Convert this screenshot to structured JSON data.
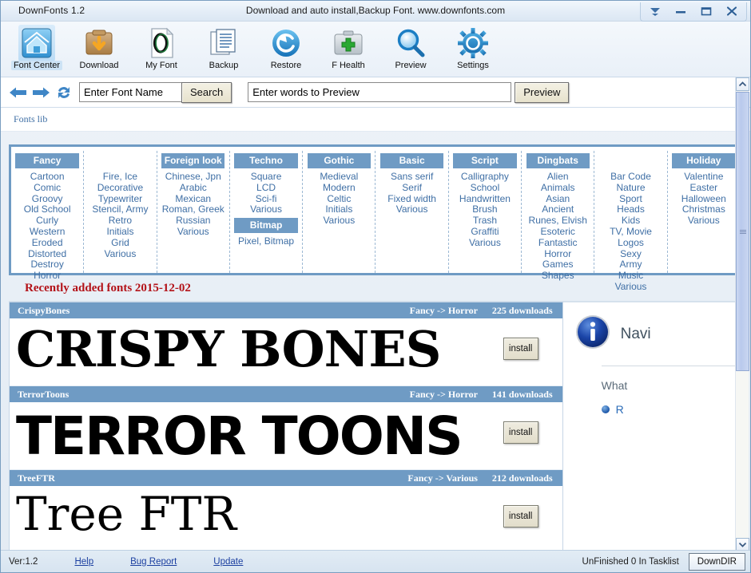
{
  "window": {
    "app_title": "DownFonts 1.2",
    "subtitle": "Download and auto install,Backup Font. www.downfonts.com",
    "buttons": {
      "dropdown": "dropdown-arrow",
      "minimize": "minimize",
      "maximize": "maximize",
      "close": "close"
    }
  },
  "toolbar": {
    "items": [
      {
        "label": "Font Center",
        "icon": "font-center-icon",
        "active": true
      },
      {
        "label": "Download",
        "icon": "download-icon",
        "active": false
      },
      {
        "label": "My Font",
        "icon": "my-font-icon",
        "active": false
      },
      {
        "label": "Backup",
        "icon": "backup-icon",
        "active": false
      },
      {
        "label": "Restore",
        "icon": "restore-icon",
        "active": false
      },
      {
        "label": "F Health",
        "icon": "health-icon",
        "active": false
      },
      {
        "label": "Preview",
        "icon": "preview-magnifier-icon",
        "active": false
      },
      {
        "label": "Settings",
        "icon": "gear-icon",
        "active": false
      }
    ]
  },
  "search": {
    "font_name_value": "",
    "font_name_placeholder": "Enter Font Name",
    "search_label": "Search",
    "preview_value": "",
    "preview_placeholder": "Enter words to Preview",
    "preview_label": "Preview"
  },
  "breadcrumb": {
    "text": "Fonts lib"
  },
  "categories": {
    "columns": [
      {
        "header": "Fancy",
        "items": [
          "Cartoon",
          "Comic",
          "Groovy",
          "Old School",
          "Curly",
          "Western",
          "Eroded",
          "Distorted",
          "Destroy",
          "Horror"
        ]
      },
      {
        "header": "",
        "items": [
          "Fire, Ice",
          "Decorative",
          "Typewriter",
          "Stencil, Army",
          "Retro",
          "Initials",
          "Grid",
          "Various"
        ]
      },
      {
        "header": "Foreign look",
        "items": [
          "Chinese, Jpn",
          "Arabic",
          "Mexican",
          "Roman, Greek",
          "Russian",
          "Various"
        ]
      },
      {
        "header": "Techno",
        "items": [
          "Square",
          "LCD",
          "Sci-fi",
          "Various"
        ],
        "header2": "Bitmap",
        "items2": [
          "Pixel, Bitmap"
        ]
      },
      {
        "header": "Gothic",
        "items": [
          "Medieval",
          "Modern",
          "Celtic",
          "Initials",
          "Various"
        ]
      },
      {
        "header": "Basic",
        "items": [
          "Sans serif",
          "Serif",
          "Fixed width",
          "Various"
        ]
      },
      {
        "header": "Script",
        "items": [
          "Calligraphy",
          "School",
          "Handwritten",
          "Brush",
          "Trash",
          "Graffiti",
          "Various"
        ]
      },
      {
        "header": "Dingbats",
        "items": [
          "Alien",
          "Animals",
          "Asian",
          "Ancient",
          "Runes, Elvish",
          "Esoteric",
          "Fantastic",
          "Horror",
          "Games",
          "Shapes"
        ]
      },
      {
        "header": "",
        "items": [
          "Bar Code",
          "Nature",
          "Sport",
          "Heads",
          "Kids",
          "TV, Movie",
          "Logos",
          "Sexy",
          "Army",
          "Music",
          "Various"
        ]
      },
      {
        "header": "Holiday",
        "items": [
          "Valentine",
          "Easter",
          "Halloween",
          "Christmas",
          "Various"
        ]
      }
    ]
  },
  "recently_added": {
    "label": "Recently added fonts 2015-12-02"
  },
  "font_list": {
    "install_label": "install",
    "rows": [
      {
        "name": "CrispyBones",
        "category": "Fancy -> Horror",
        "downloads": "225 downloads",
        "sample": "CRISPY BONES"
      },
      {
        "name": "TerrorToons",
        "category": "Fancy -> Horror",
        "downloads": "141 downloads",
        "sample": "TERROR TOONS"
      },
      {
        "name": "TreeFTR",
        "category": "Fancy -> Various",
        "downloads": "212 downloads",
        "sample": "Tree FTR"
      }
    ]
  },
  "navi_panel": {
    "icon": "info-icon",
    "title": "Navi",
    "subtitle": "What",
    "link": "R"
  },
  "statusbar": {
    "version": "Ver:1.2",
    "help": "Help",
    "bug_report": "Bug Report",
    "update": "Update",
    "task_status": "UnFinished 0 In Tasklist",
    "downdir_label": "DownDIR"
  },
  "colors": {
    "accent_blue": "#6f9bc4",
    "link_blue": "#3f6fa5",
    "recent_red": "#b31218",
    "titlebar": "#e4edf7"
  }
}
